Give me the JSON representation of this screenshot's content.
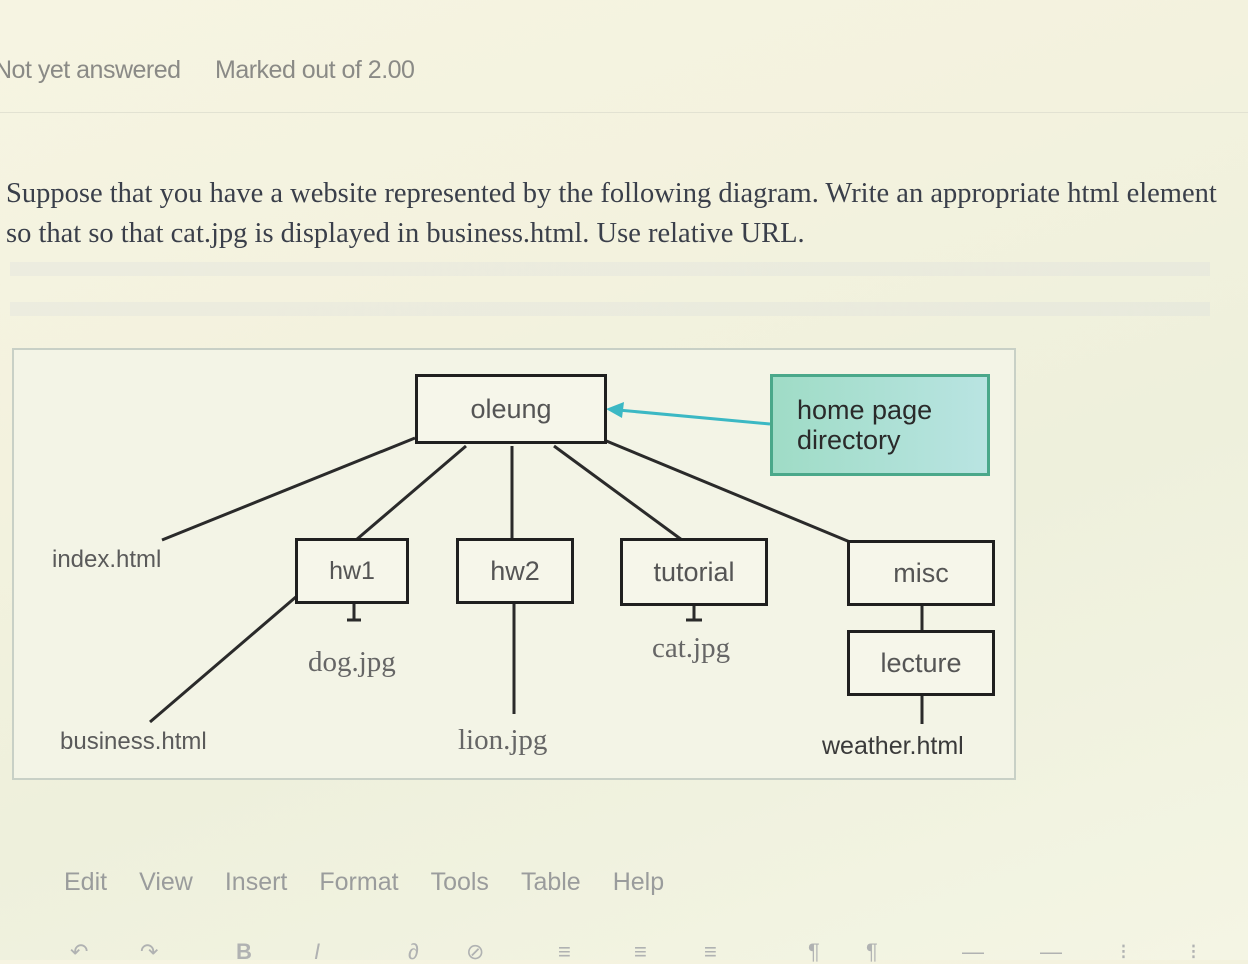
{
  "status": {
    "state": "Not yet answered",
    "marks": "Marked out of 2.00"
  },
  "question": {
    "text": "Suppose that you have a website represented by the following diagram. Write an appropriate html element so that so that cat.jpg is displayed in business.html. Use relative URL."
  },
  "diagram": {
    "root": "oleung",
    "callout": "home page directory",
    "index": "index.html",
    "business": "business.html",
    "folders": {
      "hw1": "hw1",
      "hw2": "hw2",
      "tutorial": "tutorial",
      "misc": "misc",
      "lecture": "lecture"
    },
    "files": {
      "dog": "dog.jpg",
      "cat": "cat.jpg",
      "lion": "lion.jpg",
      "weather": "weather.html"
    },
    "colors": {
      "callout_fill": "#a9e0d2",
      "callout_border": "#4aa88a",
      "arrow": "#3bb8c4"
    }
  },
  "editor_menu": [
    "Edit",
    "View",
    "Insert",
    "Format",
    "Tools",
    "Table",
    "Help"
  ],
  "toolbar_icons": [
    "undo-icon",
    "redo-icon",
    "bold-icon",
    "italic-icon",
    "link-icon",
    "unlink-icon",
    "align-left-icon",
    "align-center-icon",
    "align-right-icon",
    "ltr-icon",
    "rtl-icon",
    "indent-icon",
    "outdent-icon",
    "bullet-list-icon",
    "numbered-list-icon"
  ]
}
